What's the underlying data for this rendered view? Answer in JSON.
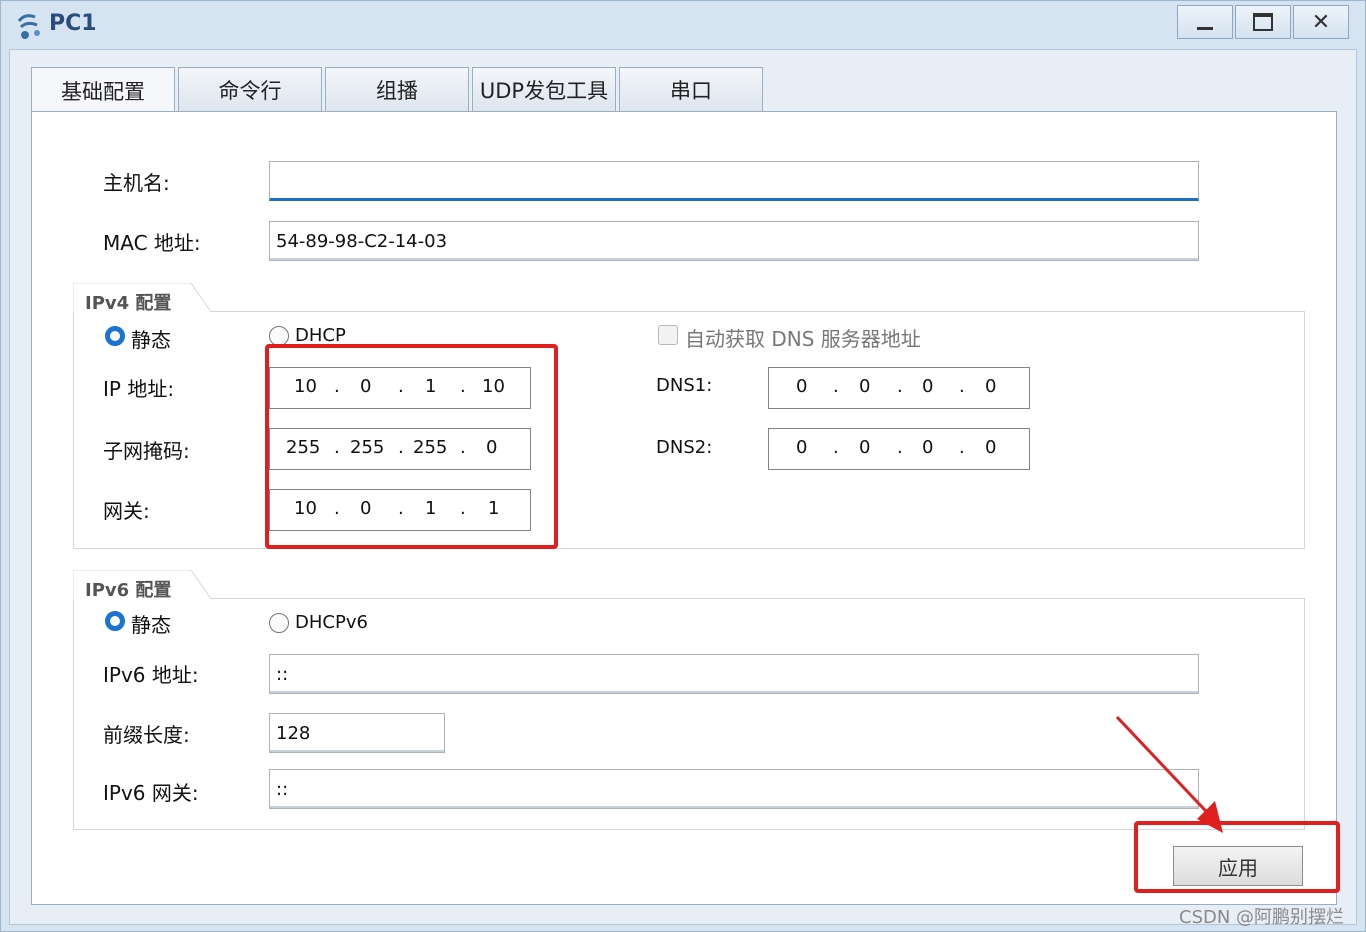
{
  "window": {
    "title": "PC1"
  },
  "tabs": [
    {
      "label": "基础配置"
    },
    {
      "label": "命令行"
    },
    {
      "label": "组播"
    },
    {
      "label": "UDP发包工具"
    },
    {
      "label": "串口"
    }
  ],
  "form": {
    "hostname_label": "主机名:",
    "hostname_value": "",
    "mac_label": "MAC 地址:",
    "mac_value": "54-89-98-C2-14-03"
  },
  "ipv4": {
    "group_title": "IPv4 配置",
    "static_label": "静态",
    "dhcp_label": "DHCP",
    "dns_auto_label": "自动获取 DNS 服务器地址",
    "ip_label": "IP 地址:",
    "ip": [
      "10",
      "0",
      "1",
      "10"
    ],
    "mask_label": "子网掩码:",
    "mask": [
      "255",
      "255",
      "255",
      "0"
    ],
    "gateway_label": "网关:",
    "gateway": [
      "10",
      "0",
      "1",
      "1"
    ],
    "dns1_label": "DNS1:",
    "dns1": [
      "0",
      "0",
      "0",
      "0"
    ],
    "dns2_label": "DNS2:",
    "dns2": [
      "0",
      "0",
      "0",
      "0"
    ]
  },
  "ipv6": {
    "group_title": "IPv6 配置",
    "static_label": "静态",
    "dhcp_label": "DHCPv6",
    "addr_label": "IPv6 地址:",
    "addr_value": "::",
    "prefix_label": "前缀长度:",
    "prefix_value": "128",
    "gateway_label": "IPv6 网关:",
    "gateway_value": "::"
  },
  "apply_label": "应用",
  "watermark": "CSDN @阿鹏别摆烂",
  "colors": {
    "accent": "#1b74d1",
    "highlight": "#e01f1f",
    "title": "#2a4e7c"
  }
}
